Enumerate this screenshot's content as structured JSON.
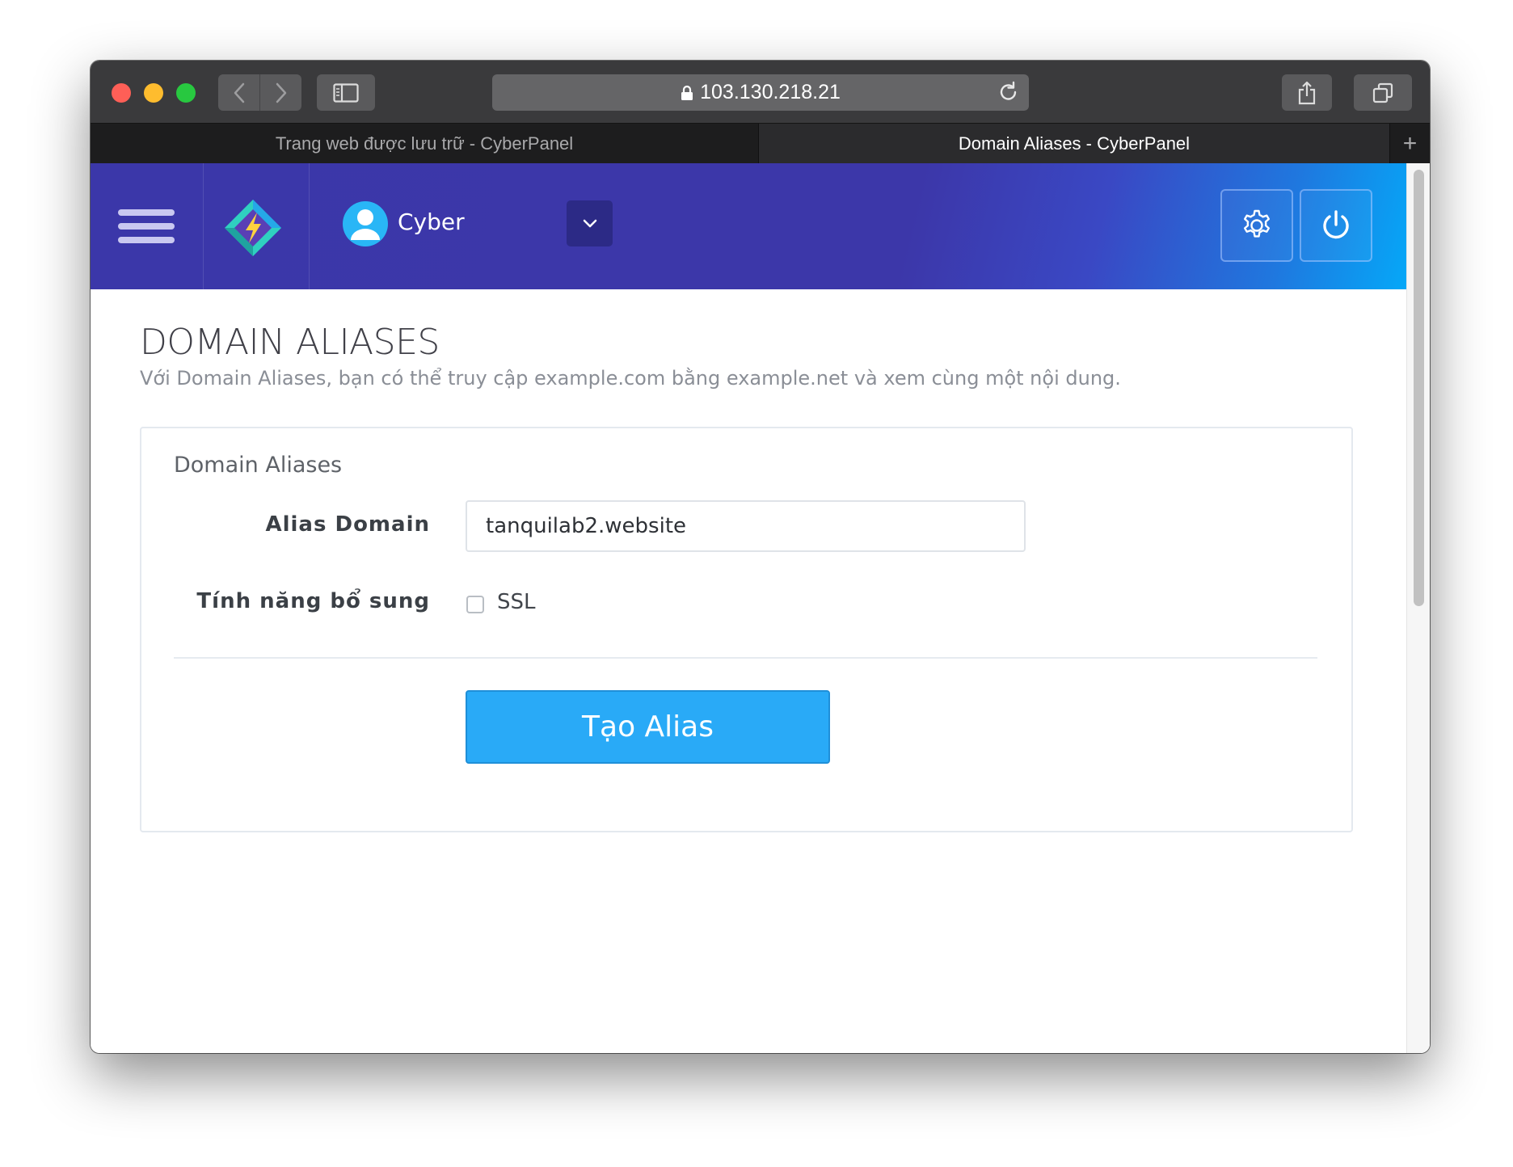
{
  "browser": {
    "address": "103.130.218.21",
    "tabs": [
      {
        "label": "Trang web được lưu trữ - CyberPanel"
      },
      {
        "label": "Domain Aliases - CyberPanel"
      }
    ],
    "new_tab_label": "+"
  },
  "header": {
    "username": "Cyber"
  },
  "page": {
    "title": "DOMAIN ALIASES",
    "subtitle": "Với Domain Aliases, bạn có thể truy cập example.com bằng example.net và xem cùng một nội dung."
  },
  "panel": {
    "title": "Domain Aliases",
    "alias_label": "Alias Domain",
    "alias_value": "tanquilab2.website",
    "features_label": "Tính năng bổ sung",
    "ssl_label": "SSL",
    "ssl_checked": false,
    "submit_label": "Tạo Alias"
  },
  "colors": {
    "header_primary": "#3b37a9",
    "header_accent": "#05a8f8",
    "button": "#29aaf7"
  },
  "icons": {
    "menu": "hamburger-icon",
    "logo": "cyberpanel-logo-icon",
    "user": "user-avatar-icon",
    "dropdown": "chevron-down-icon",
    "settings": "gear-icon",
    "logout": "power-icon"
  }
}
